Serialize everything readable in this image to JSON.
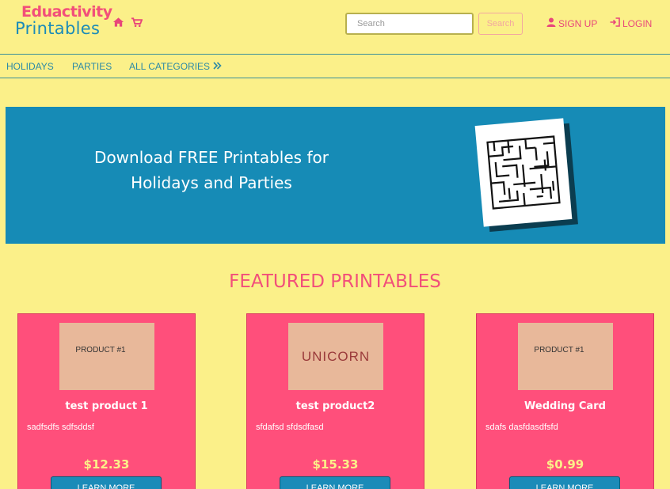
{
  "brand": {
    "line1": "Eduactivity",
    "line2": "Printables"
  },
  "header": {
    "home_icon": "home-icon",
    "cart_icon": "cart-icon",
    "search_placeholder": "Search",
    "search_button": "Search",
    "signup_label": "SIGN UP",
    "login_label": "LOGIN"
  },
  "nav": {
    "items": [
      "HOLIDAYS",
      "PARTIES",
      "ALL CATEGORIES"
    ],
    "more_icon": "double-chevron-right-icon"
  },
  "banner": {
    "line1": "Download FREE Printables for",
    "line2": "Holidays and Parties",
    "image": "maze-printable"
  },
  "featured": {
    "title": "FEATURED PRINTABLES",
    "products": [
      {
        "thumb": "PRODUCT #1",
        "title": "test product 1",
        "desc": "sadfsdfs sdfsddsf",
        "price": "$12.33",
        "button": "LEARN MORE"
      },
      {
        "thumb": "UNICORN",
        "title": "test product2",
        "desc": "sfdafsd sfdsdfasd",
        "price": "$15.33",
        "button": "LEARN MORE"
      },
      {
        "thumb": "PRODUCT #1",
        "title": "Wedding Card",
        "desc": "sdafs dasfdasdfsfd",
        "price": "$0.99",
        "button": "LEARN MORE"
      }
    ]
  },
  "colors": {
    "background": "#fbf089",
    "accent_pink": "#ff4f7b",
    "accent_blue": "#168bb6"
  }
}
